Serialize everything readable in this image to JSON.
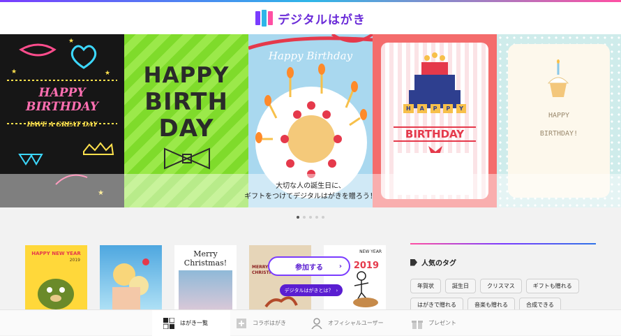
{
  "brand": {
    "name": "デジタルはがき"
  },
  "hero": {
    "cards": [
      {
        "lines": [
          "HAPPY",
          "BIRTHDAY",
          "HAVE A GREAT DAY"
        ]
      },
      {
        "lines": [
          "HAPPY",
          "BIRTH",
          "DAY"
        ]
      },
      {
        "lines": [
          "Happy Birthday"
        ]
      },
      {
        "lines": [
          "H",
          "A",
          "P",
          "P",
          "Y",
          "BIRTHDAY"
        ]
      },
      {
        "lines": [
          "HAPPY",
          "BIRTHDAY!"
        ]
      }
    ],
    "caption_line1": "大切な人の誕生日に、",
    "caption_line2": "ギフトをつけてデジタルはがきを贈ろう！",
    "active_slide": 1,
    "slide_count": 5
  },
  "thumbnails": [
    {
      "text": "HAPPY NEW YEAR",
      "year": "2019"
    },
    {
      "text": ""
    },
    {
      "text_line1": "Merry",
      "text_line2": "Christmas!"
    },
    {
      "text": "MERRY CHRISTMAS"
    },
    {
      "text": "NEW YEAR",
      "year": "2019"
    }
  ],
  "cta": {
    "join_label": "参加する",
    "about_label": "デジタルはがきとは？"
  },
  "tags": {
    "title": "人気のタグ",
    "items": [
      "年賀状",
      "誕生日",
      "クリスマス",
      "ギフトも贈れる",
      "はがきで贈れる",
      "音楽も贈れる",
      "合成できる"
    ]
  },
  "nav": {
    "items": [
      {
        "label": "はがき一覧",
        "icon": "grid-icon",
        "active": true
      },
      {
        "label": "コラボはがき",
        "icon": "plus-card-icon",
        "active": false
      },
      {
        "label": "オフィシャルユーザー",
        "icon": "user-icon",
        "active": false
      },
      {
        "label": "プレゼント",
        "icon": "gift-icon",
        "active": false
      }
    ]
  }
}
